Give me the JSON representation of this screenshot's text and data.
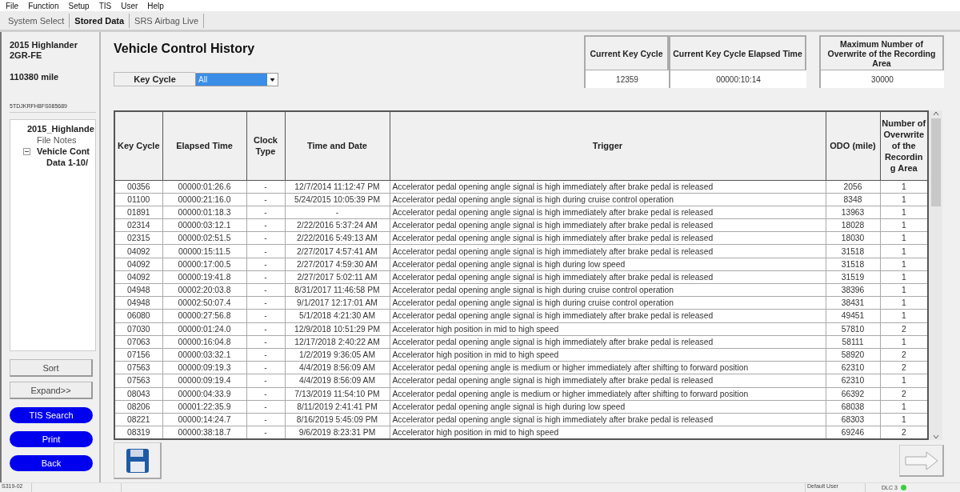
{
  "menu": [
    "File",
    "Function",
    "Setup",
    "TIS",
    "User",
    "Help"
  ],
  "tabs": [
    {
      "label": "System Select",
      "selected": false
    },
    {
      "label": "Stored Data",
      "selected": true
    },
    {
      "label": "SRS Airbag Live",
      "selected": false
    }
  ],
  "sidebar": {
    "vehicle": "2015 Highlander",
    "engine": "2GR-FE",
    "mileage": "110380 mile",
    "vin": "5TDJKRFH8FS085689",
    "tree": [
      {
        "label": "2015_Highlande",
        "bold": true,
        "children": [
          {
            "label": "File Notes",
            "bold": false
          },
          {
            "label": "Vehicle Cont",
            "bold": true,
            "expanded": true,
            "children": [
              {
                "label": "Data 1-10/",
                "bold": true
              }
            ]
          }
        ]
      }
    ],
    "buttons": [
      {
        "label": "Sort",
        "kind": "plain"
      },
      {
        "label": "Expand>>",
        "kind": "plain"
      },
      {
        "label": "TIS Search",
        "kind": "blue"
      },
      {
        "label": "Print",
        "kind": "blue"
      },
      {
        "label": "Back",
        "kind": "blue"
      }
    ]
  },
  "page_title": "Vehicle Control History",
  "filter": {
    "label": "Key Cycle",
    "value": "All"
  },
  "summary": [
    {
      "header": "Current Key Cycle",
      "value": "12359"
    },
    {
      "header": "Current Key Cycle Elapsed Time",
      "value": "00000:10:14"
    },
    {
      "header": "Maximum Number of Overwrite of the Recording Area",
      "value": "30000"
    }
  ],
  "table": {
    "columns": [
      "Key Cycle",
      "Elapsed Time",
      "Clock Type",
      "Time and Date",
      "Trigger",
      "ODO (mile)",
      "Number of Overwrite of the Recordin g Area"
    ],
    "rows": [
      [
        "00356",
        "00000:01:26.6",
        "-",
        "12/7/2014 11:12:47 PM",
        "Accelerator pedal opening angle signal is high immediately after brake pedal is released",
        "2056",
        "1"
      ],
      [
        "01100",
        "00000:21:16.0",
        "-",
        "5/24/2015 10:05:39 PM",
        "Accelerator pedal opening angle signal is high during cruise control operation",
        "8348",
        "1"
      ],
      [
        "01891",
        "00000:01:18.3",
        "-",
        "-",
        "Accelerator pedal opening angle signal is high immediately after brake pedal is released",
        "13963",
        "1"
      ],
      [
        "02314",
        "00000:03:12.1",
        "-",
        "2/22/2016 5:37:24 AM",
        "Accelerator pedal opening angle signal is high immediately after brake pedal is released",
        "18028",
        "1"
      ],
      [
        "02315",
        "00000:02:51.5",
        "-",
        "2/22/2016 5:49:13 AM",
        "Accelerator pedal opening angle signal is high immediately after brake pedal is released",
        "18030",
        "1"
      ],
      [
        "04092",
        "00000:15:11.5",
        "-",
        "2/27/2017 4:57:41 AM",
        "Accelerator pedal opening angle signal is high immediately after brake pedal is released",
        "31518",
        "1"
      ],
      [
        "04092",
        "00000:17:00.5",
        "-",
        "2/27/2017 4:59:30 AM",
        "Accelerator pedal opening angle signal is high during low speed",
        "31518",
        "1"
      ],
      [
        "04092",
        "00000:19:41.8",
        "-",
        "2/27/2017 5:02:11 AM",
        "Accelerator pedal opening angle signal is high immediately after brake pedal is released",
        "31519",
        "1"
      ],
      [
        "04948",
        "00002:20:03.8",
        "-",
        "8/31/2017 11:46:58 PM",
        "Accelerator pedal opening angle signal is high during cruise control operation",
        "38396",
        "1"
      ],
      [
        "04948",
        "00002:50:07.4",
        "-",
        "9/1/2017 12:17:01 AM",
        "Accelerator pedal opening angle signal is high during cruise control operation",
        "38431",
        "1"
      ],
      [
        "06080",
        "00000:27:56.8",
        "-",
        "5/1/2018 4:21:30 AM",
        "Accelerator pedal opening angle signal is high immediately after brake pedal is released",
        "49451",
        "1"
      ],
      [
        "07030",
        "00000:01:24.0",
        "-",
        "12/9/2018 10:51:29 PM",
        "Accelerator high position in mid to high speed",
        "57810",
        "2"
      ],
      [
        "07063",
        "00000:16:04.8",
        "-",
        "12/17/2018 2:40:22 AM",
        "Accelerator pedal opening angle signal is high immediately after brake pedal is released",
        "58111",
        "1"
      ],
      [
        "07156",
        "00000:03:32.1",
        "-",
        "1/2/2019 9:36:05 AM",
        "Accelerator high position in mid to high speed",
        "58920",
        "2"
      ],
      [
        "07563",
        "00000:09:19.3",
        "-",
        "4/4/2019 8:56:09 AM",
        "Accelerator pedal opening angle is medium or higher immediately after shifting to forward position",
        "62310",
        "2"
      ],
      [
        "07563",
        "00000:09:19.4",
        "-",
        "4/4/2019 8:56:09 AM",
        "Accelerator pedal opening angle signal is high immediately after brake pedal is released",
        "62310",
        "1"
      ],
      [
        "08043",
        "00000:04:33.9",
        "-",
        "7/13/2019 11:54:10 PM",
        "Accelerator pedal opening angle is medium or higher immediately after shifting to forward position",
        "66392",
        "2"
      ],
      [
        "08206",
        "00001:22:35.9",
        "-",
        "8/11/2019 2:41:41 PM",
        "Accelerator pedal opening angle signal is high during low speed",
        "68038",
        "1"
      ],
      [
        "08221",
        "00000:14:24.7",
        "-",
        "8/16/2019 5:45:09 PM",
        "Accelerator pedal opening angle signal is high immediately after brake pedal is released",
        "68303",
        "1"
      ],
      [
        "08319",
        "00000:38:18.7",
        "-",
        "9/6/2019 8:23:31 PM",
        "Accelerator high position in mid to high speed",
        "69246",
        "2"
      ]
    ]
  },
  "status_bar": {
    "code": "S319-02",
    "user": "Default User",
    "port": "DLC 3"
  }
}
